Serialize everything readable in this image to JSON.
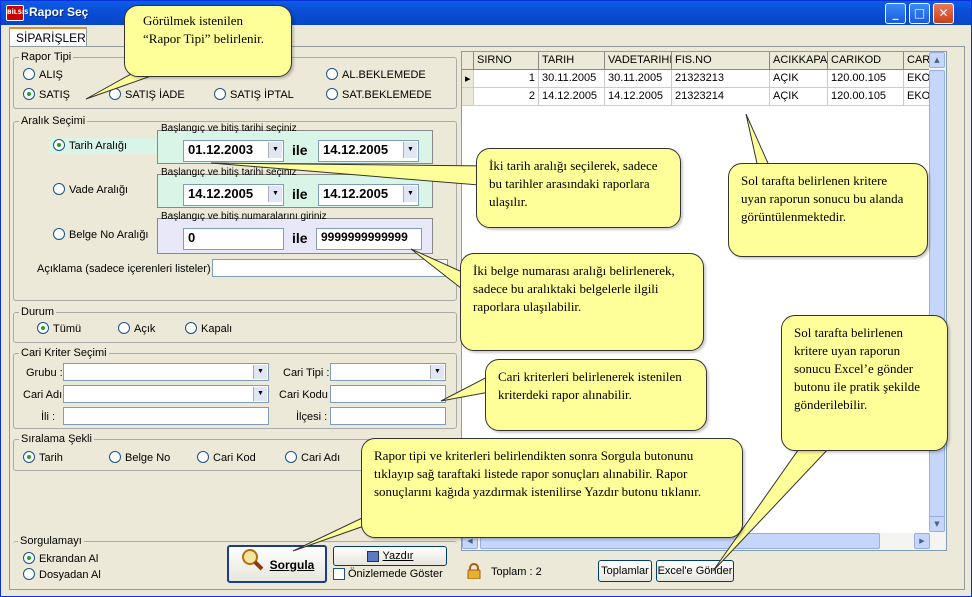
{
  "window": {
    "title": "Rapor Seç",
    "app_icon_text": "BİLSİS"
  },
  "tabs": [
    {
      "label": "SİPARİŞLER"
    }
  ],
  "rapor_tipi": {
    "label": "Rapor Tipi",
    "options": [
      "ALIŞ",
      "SATIŞ",
      "SATIŞ İADE",
      "SATIŞ İPTAL",
      "AL.BEKLEMEDE",
      "SAT.BEKLEMEDE"
    ],
    "selected": "SATIŞ"
  },
  "aralik": {
    "label": "Aralık Seçimi",
    "tarih_label": "Tarih Aralığı",
    "vade_label": "Vade Aralığı",
    "belge_label": "Belge No Aralığı",
    "date_hint": "Başlangıç ve bitiş tarihi seçiniz",
    "number_hint": "Başlangıç ve bitiş numaralarını giriniz",
    "ile": "ile",
    "tarih_start": "01.12.2003",
    "tarih_end": "14.12.2005",
    "vade_start": "14.12.2005",
    "vade_end": "14.12.2005",
    "belge_start": "0",
    "belge_end": "9999999999999",
    "aciklama_label": "Açıklama (sadece içerenleri listeler) :",
    "aciklama_value": ""
  },
  "durum": {
    "label": "Durum",
    "options": [
      "Tümü",
      "Açık",
      "Kapalı"
    ],
    "selected": "Tümü"
  },
  "cari": {
    "label": "Cari Kriter Seçimi",
    "grubu": "Grubu :",
    "cari_tipi": "Cari Tipi :",
    "cari_adi": "Cari Adı",
    "cari_kodu": "Cari Kodu",
    "ili": "İli :",
    "ilcesi": "İlçesi :"
  },
  "siralama": {
    "label": "Sıralama Şekli",
    "options": [
      "Tarih",
      "Belge No",
      "Cari Kod",
      "Cari Adı"
    ],
    "selected": "Tarih"
  },
  "sorgulama": {
    "label": "Sorgulamayı",
    "options": [
      "Ekrandan Al",
      "Dosyadan Al"
    ],
    "selected": "Ekrandan Al"
  },
  "buttons": {
    "sorgula": "Sorgula",
    "yazdir": "Yazdır",
    "onizleme": "Önizlemede Göster",
    "toplamlar": "Toplamlar",
    "excel": "Excel'e Gönder"
  },
  "grid": {
    "columns": [
      "SIRNO",
      "TARIH",
      "VADETARIHI",
      "FIS.NO",
      "ACIKKAPA",
      "CARIKOD",
      "CARIAD"
    ],
    "rows": [
      [
        "1",
        "30.11.2005",
        "30.11.2005",
        "21323213",
        "AÇIK",
        "120.00.105",
        "EKOBİM"
      ],
      [
        "2",
        "14.12.2005",
        "14.12.2005",
        "21323214",
        "AÇIK",
        "120.00.105",
        "EKOBİM"
      ]
    ]
  },
  "status": {
    "toplam": "Toplam : 2"
  },
  "callouts": {
    "rapor_tipi": "Görülmek istenilen “Rapor Tipi” belirlenir.",
    "tarih": "İki tarih aralığı seçilerek, sadece bu tarihler arasındaki raporlara ulaşılır.",
    "belge": "İki belge numarası aralığı belirlenerek, sadece bu aralıktaki belgelerle ilgili raporlara ulaşılabilir.",
    "cari": "Cari kriterleri belirlenerek istenilen kriterdeki rapor alınabilir.",
    "sorgula": "Rapor tipi ve kriterleri belirlendikten sonra Sorgula butonunu tıklayıp sağ taraftaki listede rapor sonuçları alınabilir. Rapor sonuçlarını kağıda yazdırmak istenilirse Yazdır butonu tıklanır.",
    "sonuc": "Sol tarafta belirlenen kritere uyan raporun sonucu bu alanda görüntülenmektedir.",
    "excel": "Sol tarafta belirlenen kritere uyan raporun sonucu Excel’e gönder butonu ile pratik şekilde gönderilebilir."
  },
  "colors": {
    "titlebar": "#0a5ee8",
    "callout": "#ffff99",
    "date_panel": "#d8f5e8",
    "number_panel": "#e8e8f8"
  }
}
